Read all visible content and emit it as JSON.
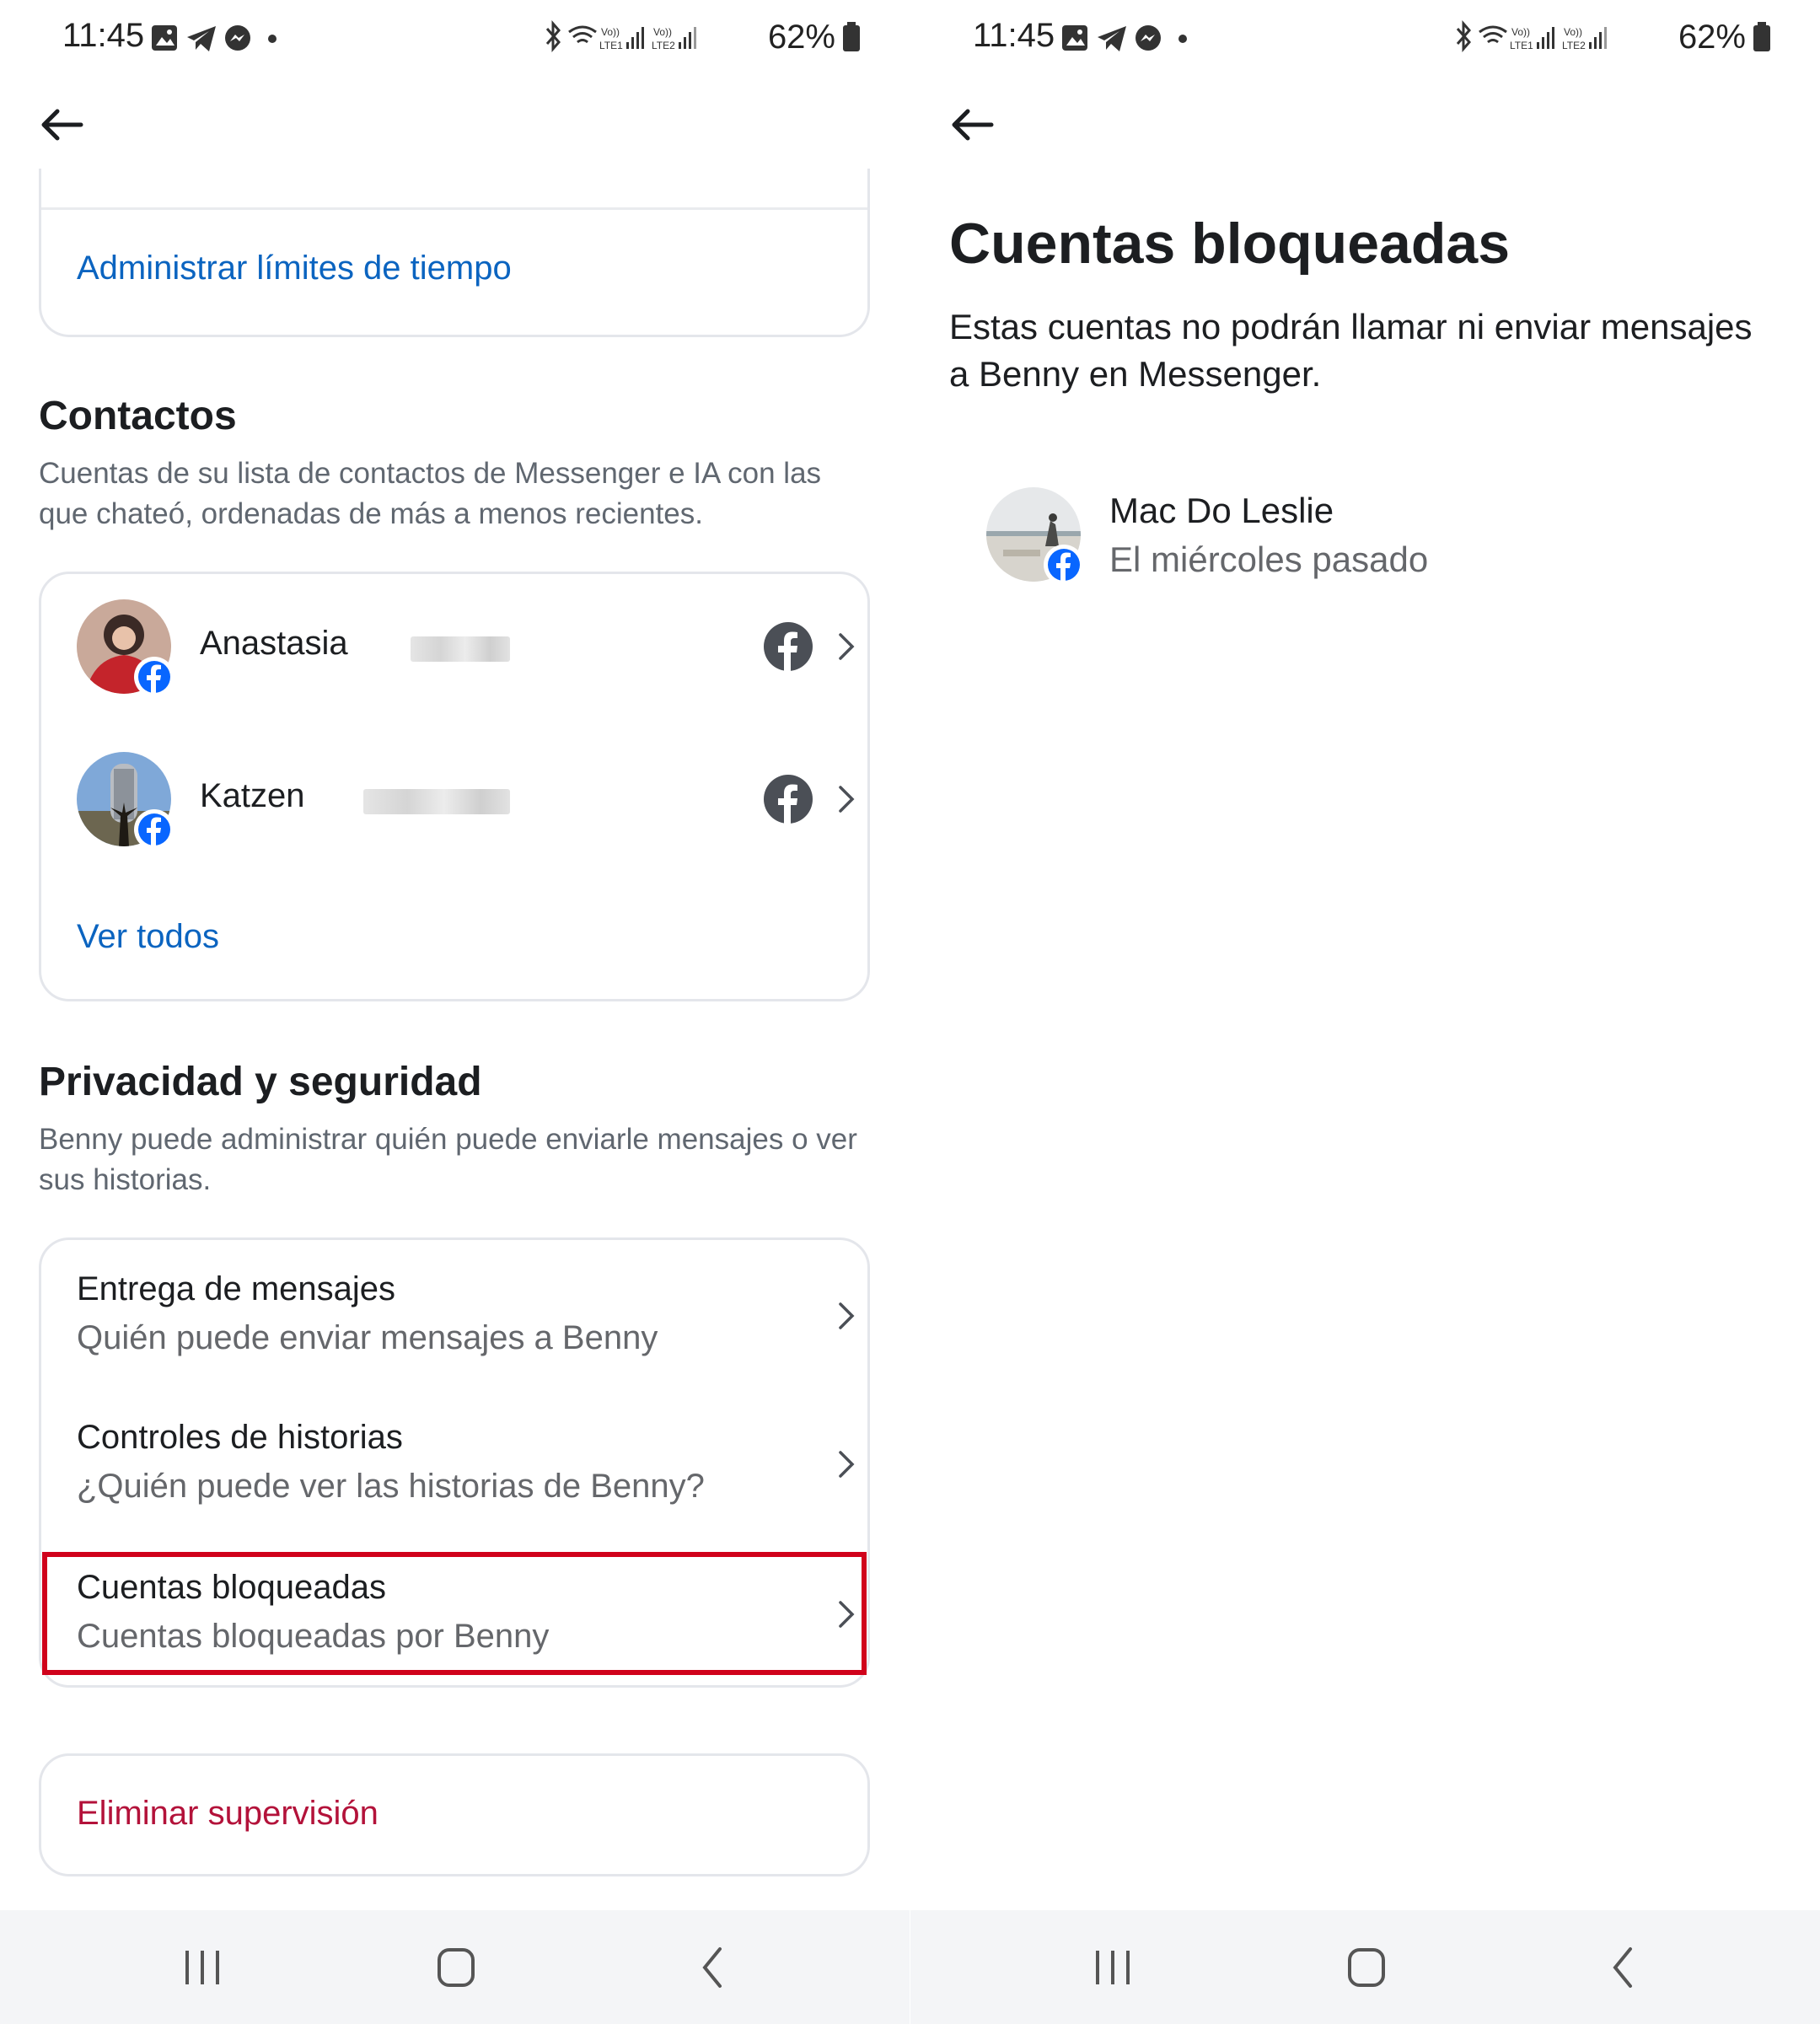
{
  "status_bar": {
    "time": "11:45",
    "battery_pct": "62%",
    "network_labels": [
      "Vo)) LTE1",
      "Vo)) LTE2"
    ]
  },
  "left_screen": {
    "time_limits_link": "Administrar límites de tiempo",
    "contacts": {
      "title": "Contactos",
      "description": "Cuentas de su lista de contactos de Messenger e IA con las que chateó, ordenadas de más a menos recientes.",
      "items": [
        {
          "name": "Anastasia",
          "source_icon": "facebook-icon"
        },
        {
          "name": "Katzen",
          "source_icon": "facebook-icon"
        }
      ],
      "see_all": "Ver todos"
    },
    "privacy": {
      "title": "Privacidad y seguridad",
      "description": "Benny puede administrar quién puede enviarle mensajes o ver sus historias.",
      "items": [
        {
          "title": "Entrega de mensajes",
          "subtitle": "Quién puede enviar mensajes a Benny"
        },
        {
          "title": "Controles de historias",
          "subtitle": "¿Quién puede ver las historias de Benny?"
        },
        {
          "title": "Cuentas bloqueadas",
          "subtitle": "Cuentas bloqueadas por Benny",
          "highlighted": true
        }
      ]
    },
    "remove_supervision": "Eliminar supervisión"
  },
  "right_screen": {
    "title": "Cuentas bloqueadas",
    "description": "Estas cuentas no podrán llamar ni enviar mensajes a Benny en Messenger.",
    "blocked_accounts": [
      {
        "name": "Mac Do Leslie",
        "subtitle": "El miércoles pasado",
        "source_icon": "facebook-icon"
      }
    ]
  },
  "colors": {
    "link_blue": "#0b64c0",
    "danger_red": "#b3123a",
    "highlight_red": "#d0021b",
    "facebook_blue": "#0866ff"
  }
}
